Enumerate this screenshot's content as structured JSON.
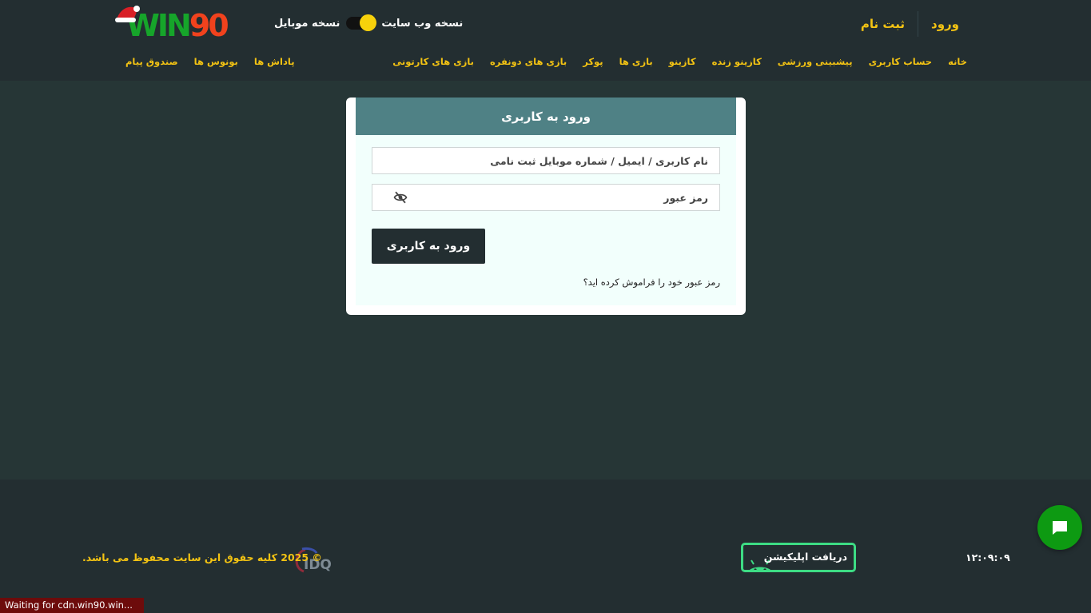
{
  "header": {
    "auth": {
      "login_label": "ورود",
      "register_label": "ثبت نام"
    },
    "logo": {
      "text_win": "WIN",
      "text_num": "90"
    },
    "version_toggle": {
      "web_label": "نسخه وب سایت",
      "mobile_label": "نسخه موبایل"
    },
    "nav_main": [
      {
        "label": "خانه"
      },
      {
        "label": "حساب کاربری"
      },
      {
        "label": "پیشبینی ورزشی"
      },
      {
        "label": "کازینو زنده"
      },
      {
        "label": "کازینو"
      },
      {
        "label": "بازی ها"
      },
      {
        "label": "پوکر"
      },
      {
        "label": "بازی های دونفره"
      },
      {
        "label": "بازی های کارتونی"
      }
    ],
    "nav_secondary": [
      {
        "label": "پاداش ها"
      },
      {
        "label": "بونوس ها"
      },
      {
        "label": "صندوق پیام"
      }
    ]
  },
  "login": {
    "title": "ورود به کاربری",
    "username_placeholder": "نام کاربری / ایمیل / شماره موبایل ثبت نامی",
    "password_placeholder": "رمز عبور",
    "submit_label": "ورود به کاربری",
    "forgot_label": "رمز عبور خود را فراموش کرده اید؟"
  },
  "footer": {
    "clock": "۱۲:۰۹:۰۹",
    "app_button_label": "دریافت اپلیکیشن",
    "copyright": "© 2025 کلیه حقوق این سایت محفوظ می باشد."
  },
  "status_bar": {
    "text": "Waiting for cdn.win90.win..."
  },
  "colors": {
    "page_bg": "#263636",
    "header_bg": "#232e31",
    "accent_yellow": "#f3c313",
    "login_header_bg": "#4f8185",
    "login_body_bg": "#f2fffc",
    "button_dark": "#232e31",
    "chat_green": "#0d9a12",
    "android_green": "#3ddc84",
    "status_bar_bg": "#6d0b0b"
  },
  "icons": {
    "logo_hat": "santa-hat-icon",
    "password_toggle": "eye-off-icon",
    "app": "android-icon",
    "chat": "chat-bubble-icon",
    "footer_logo": "idq-logo"
  }
}
